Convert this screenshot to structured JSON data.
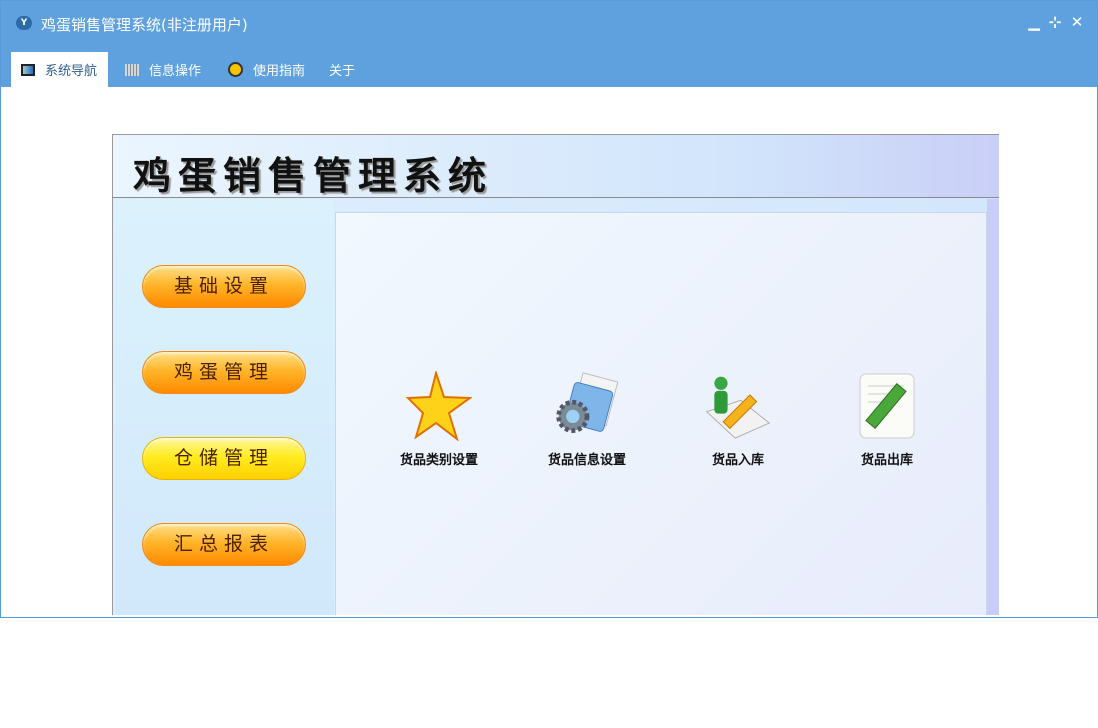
{
  "window": {
    "title": "鸡蛋销售管理系统(非注册用户)",
    "minimize": "▁",
    "restore": "⊹",
    "close": "✕",
    "app_icon": "Y"
  },
  "tabs": [
    {
      "label": "系统导航",
      "icon": "monitor-icon"
    },
    {
      "label": "信息操作",
      "icon": "grid-icon"
    },
    {
      "label": "使用指南",
      "icon": "help-icon"
    },
    {
      "label": "关于"
    }
  ],
  "header": {
    "title": "鸡蛋销售管理系统"
  },
  "nav": [
    "基础设置",
    "鸡蛋管理",
    "仓储管理",
    "汇总报表"
  ],
  "items": [
    {
      "label": "货品类别设置",
      "icon": "star-icon"
    },
    {
      "label": "货品信息设置",
      "icon": "gear-folder-icon"
    },
    {
      "label": "货品入库",
      "icon": "person-pencil-icon"
    },
    {
      "label": "货品出库",
      "icon": "document-pencil-icon"
    }
  ]
}
